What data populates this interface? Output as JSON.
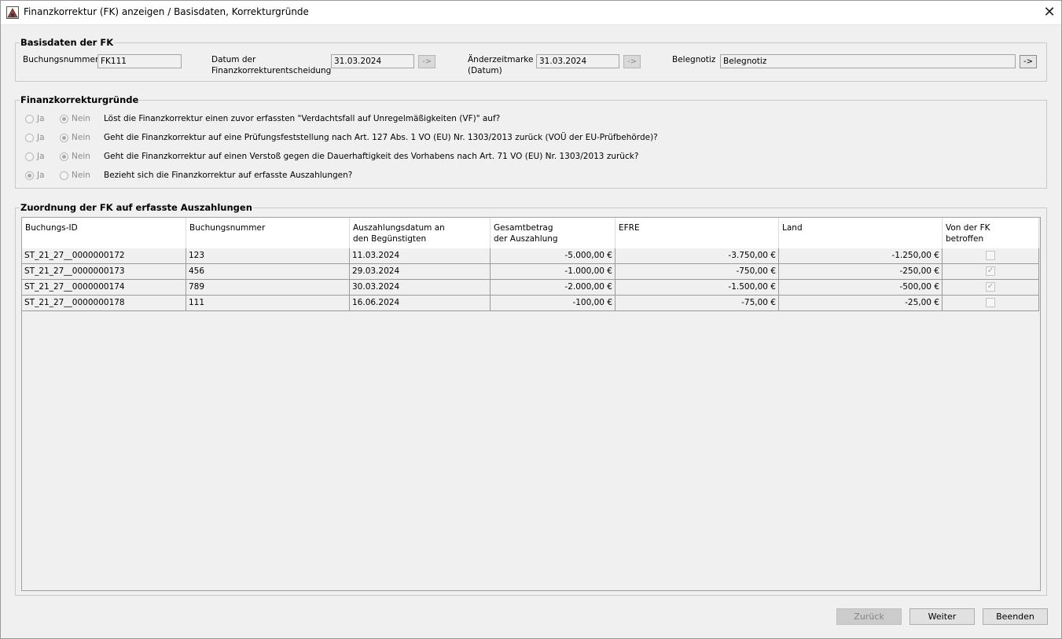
{
  "window": {
    "title": "Finanzkorrektur (FK) anzeigen / Basisdaten, Korrekturgründe",
    "close_glyph": "✕"
  },
  "basisdaten": {
    "legend": "Basisdaten der FK",
    "buchungsnummer_label": "Buchungsnummer",
    "buchungsnummer_value": "FK111",
    "datum_label_line1": "Datum der",
    "datum_label_line2": "Finanzkorrekturentscheidung",
    "datum_value": "31.03.2024",
    "aenderung_label_line1": "Änderzeitmarke",
    "aenderung_label_line2": "(Datum)",
    "aenderung_value": "31.03.2024",
    "belegnotiz_label": "Belegnotiz",
    "belegnotiz_value": "Belegnotiz",
    "arrow_label": "->"
  },
  "gruende": {
    "legend": "Finanzkorrekturgründe",
    "ja_label": "Ja",
    "nein_label": "Nein",
    "questions": [
      {
        "text": "Löst die Finanzkorrektur einen zuvor erfassten \"Verdachtsfall auf Unregelmäßigkeiten (VF)\" auf?",
        "selected": "Nein"
      },
      {
        "text": "Geht die Finanzkorrektur auf eine Prüfungsfeststellung nach Art. 127 Abs. 1 VO (EU) Nr. 1303/2013 zurück (VOÜ der EU-Prüfbehörde)?",
        "selected": "Nein"
      },
      {
        "text": "Geht die Finanzkorrektur auf einen Verstoß gegen die Dauerhaftigkeit des Vorhabens nach Art. 71 VO (EU) Nr. 1303/2013 zurück?",
        "selected": "Nein"
      },
      {
        "text": "Bezieht sich die Finanzkorrektur auf erfasste Auszahlungen?",
        "selected": "Ja"
      }
    ]
  },
  "zuordnung": {
    "legend": "Zuordnung der FK auf erfasste Auszahlungen",
    "columns": [
      {
        "line1": "Buchungs-ID",
        "line2": ""
      },
      {
        "line1": "Buchungsnummer",
        "line2": ""
      },
      {
        "line1": "Auszahlungsdatum an",
        "line2": "den Begünstigten"
      },
      {
        "line1": "Gesamtbetrag",
        "line2": "der Auszahlung"
      },
      {
        "line1": "EFRE",
        "line2": ""
      },
      {
        "line1": "Land",
        "line2": ""
      },
      {
        "line1": "Von der FK",
        "line2": "betroffen"
      }
    ],
    "rows": [
      {
        "id": "ST_21_27__0000000172",
        "nummer": "123",
        "datum": "11.03.2024",
        "gesamt": "-5.000,00 €",
        "efre": "-3.750,00 €",
        "land": "-1.250,00 €",
        "betroffen": false
      },
      {
        "id": "ST_21_27__0000000173",
        "nummer": "456",
        "datum": "29.03.2024",
        "gesamt": "-1.000,00 €",
        "efre": "-750,00 €",
        "land": "-250,00 €",
        "betroffen": true
      },
      {
        "id": "ST_21_27__0000000174",
        "nummer": "789",
        "datum": "30.03.2024",
        "gesamt": "-2.000,00 €",
        "efre": "-1.500,00 €",
        "land": "-500,00 €",
        "betroffen": true
      },
      {
        "id": "ST_21_27__0000000178",
        "nummer": "111",
        "datum": "16.06.2024",
        "gesamt": "-100,00 €",
        "efre": "-75,00 €",
        "land": "-25,00 €",
        "betroffen": false
      }
    ]
  },
  "buttons": {
    "zurueck": "Zurück",
    "weiter": "Weiter",
    "beenden": "Beenden"
  },
  "checkmark_glyph": "✓"
}
